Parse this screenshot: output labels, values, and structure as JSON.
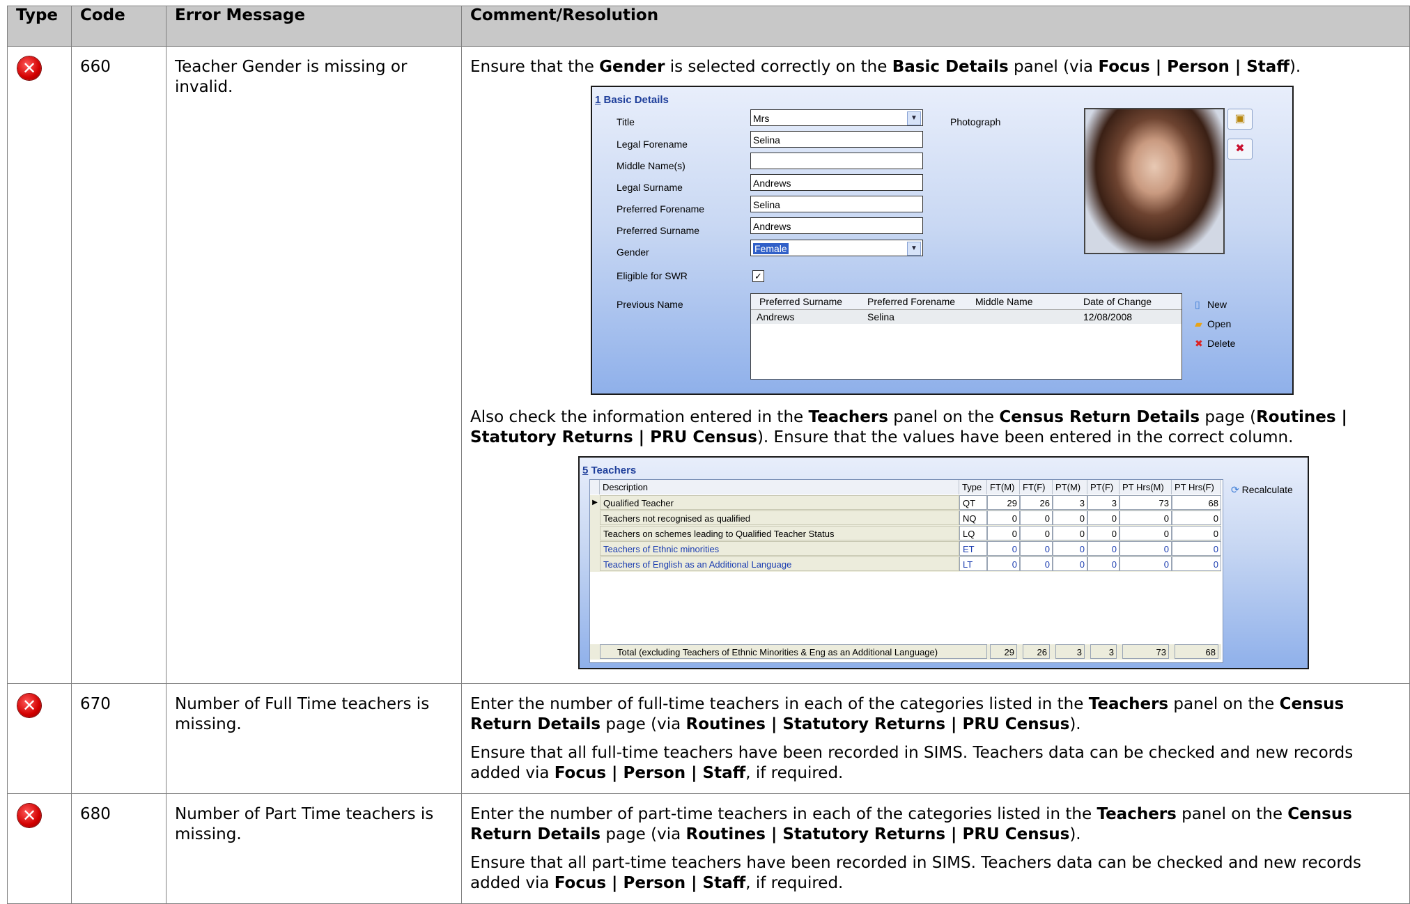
{
  "table": {
    "headers": {
      "type": "Type",
      "code": "Code",
      "error": "Error Message",
      "comment": "Comment/Resolution"
    },
    "rows": [
      {
        "code": "660",
        "message": "Teacher Gender is missing or invalid."
      },
      {
        "code": "670",
        "message": "Number of Full Time teachers is missing."
      },
      {
        "code": "680",
        "message": "Number of Part Time teachers is missing."
      }
    ],
    "error_icon_glyph": "✕"
  },
  "row660": {
    "p1_pre": "Ensure that the ",
    "p1_b1": "Gender",
    "p1_mid": " is selected correctly on the ",
    "p1_b2": "Basic Details",
    "p1_mid2": " panel (via ",
    "p1_b3": "Focus | Person | Staff",
    "p1_end": ").",
    "p2_pre": "Also check the information entered in the ",
    "p2_b1": "Teachers",
    "p2_mid": " panel on the ",
    "p2_b2": "Census Return Details",
    "p2_mid2": " page (",
    "p2_b3": "Routines | Statutory Returns | PRU Census",
    "p2_end": "). Ensure that the values have been entered in the correct column."
  },
  "row670": {
    "p1_pre": "Enter the number of full-time teachers in each of the categories listed in the ",
    "p1_b1": "Teachers",
    "p1_mid": " panel on the ",
    "p1_b2": "Census Return Details",
    "p1_mid2": " page (via ",
    "p1_b3": "Routines | Statutory Returns | PRU Census",
    "p1_end": ").",
    "p2_pre": "Ensure that all full-time teachers have been recorded in SIMS. Teachers data can be checked and new records added via ",
    "p2_b1": "Focus | Person | Staff",
    "p2_end": ", if required."
  },
  "row680": {
    "p1_pre": "Enter the number of part-time teachers in each of the categories listed in the ",
    "p1_b1": "Teachers",
    "p1_mid": " panel on the ",
    "p1_b2": "Census Return Details",
    "p1_mid2": " page (via ",
    "p1_b3": "Routines | Statutory Returns | PRU Census",
    "p1_end": ").",
    "p2_pre": "Ensure that all part-time teachers have been recorded in SIMS. Teachers data can be checked and new records added via ",
    "p2_b1": "Focus | Person | Staff",
    "p2_end": ", if required."
  },
  "basic_details": {
    "title_num": "1",
    "title": " Basic Details",
    "fields": {
      "title": {
        "label": "Title",
        "value": "Mrs"
      },
      "legal_forename": {
        "label": "Legal Forename",
        "value": "Selina"
      },
      "middle_names": {
        "label": "Middle Name(s)",
        "value": ""
      },
      "legal_surname": {
        "label": "Legal Surname",
        "value": "Andrews"
      },
      "preferred_forename": {
        "label": "Preferred Forename",
        "value": "Selina"
      },
      "preferred_surname": {
        "label": "Preferred Surname",
        "value": "Andrews"
      },
      "gender": {
        "label": "Gender",
        "value": "Female"
      },
      "swr": {
        "label": "Eligible for SWR",
        "checked": "✓"
      },
      "previous_name": {
        "label": "Previous Name"
      }
    },
    "photo_label": "Photograph",
    "prev_grid": {
      "headers": [
        "Preferred Surname",
        "Preferred Forename",
        "Middle Name",
        "Date of Change"
      ],
      "row": [
        "Andrews",
        "Selina",
        "",
        "12/08/2008"
      ]
    },
    "actions": {
      "new": "New",
      "open": "Open",
      "delete": "Delete"
    }
  },
  "teachers": {
    "title_num": "5",
    "title": " Teachers",
    "headers": [
      "Description",
      "Type",
      "FT(M)",
      "FT(F)",
      "PT(M)",
      "PT(F)",
      "PT Hrs(M)",
      "PT Hrs(F)"
    ],
    "rows": [
      {
        "desc": "Qualified Teacher",
        "type": "QT",
        "v": [
          "29",
          "26",
          "3",
          "3",
          "73",
          "68"
        ],
        "blue": false
      },
      {
        "desc": "Teachers not recognised as qualified",
        "type": "NQ",
        "v": [
          "0",
          "0",
          "0",
          "0",
          "0",
          "0"
        ],
        "blue": false
      },
      {
        "desc": "Teachers on schemes leading to Qualified Teacher Status",
        "type": "LQ",
        "v": [
          "0",
          "0",
          "0",
          "0",
          "0",
          "0"
        ],
        "blue": false
      },
      {
        "desc": "Teachers of Ethnic minorities",
        "type": "ET",
        "v": [
          "0",
          "0",
          "0",
          "0",
          "0",
          "0"
        ],
        "blue": true
      },
      {
        "desc": "Teachers of English as an Additional Language",
        "type": "LT",
        "v": [
          "0",
          "0",
          "0",
          "0",
          "0",
          "0"
        ],
        "blue": true
      }
    ],
    "total_label": "Total (excluding Teachers of Ethnic Minorities & Eng as an Additional Language)",
    "totals": [
      "29",
      "26",
      "3",
      "3",
      "73",
      "68"
    ],
    "recalculate": "Recalculate"
  },
  "colors": {
    "header_bg": "#c8c8c8",
    "error_red": "#d20000",
    "panel_blue": "#8fb0ea",
    "link_blue": "#1a3cb0"
  }
}
